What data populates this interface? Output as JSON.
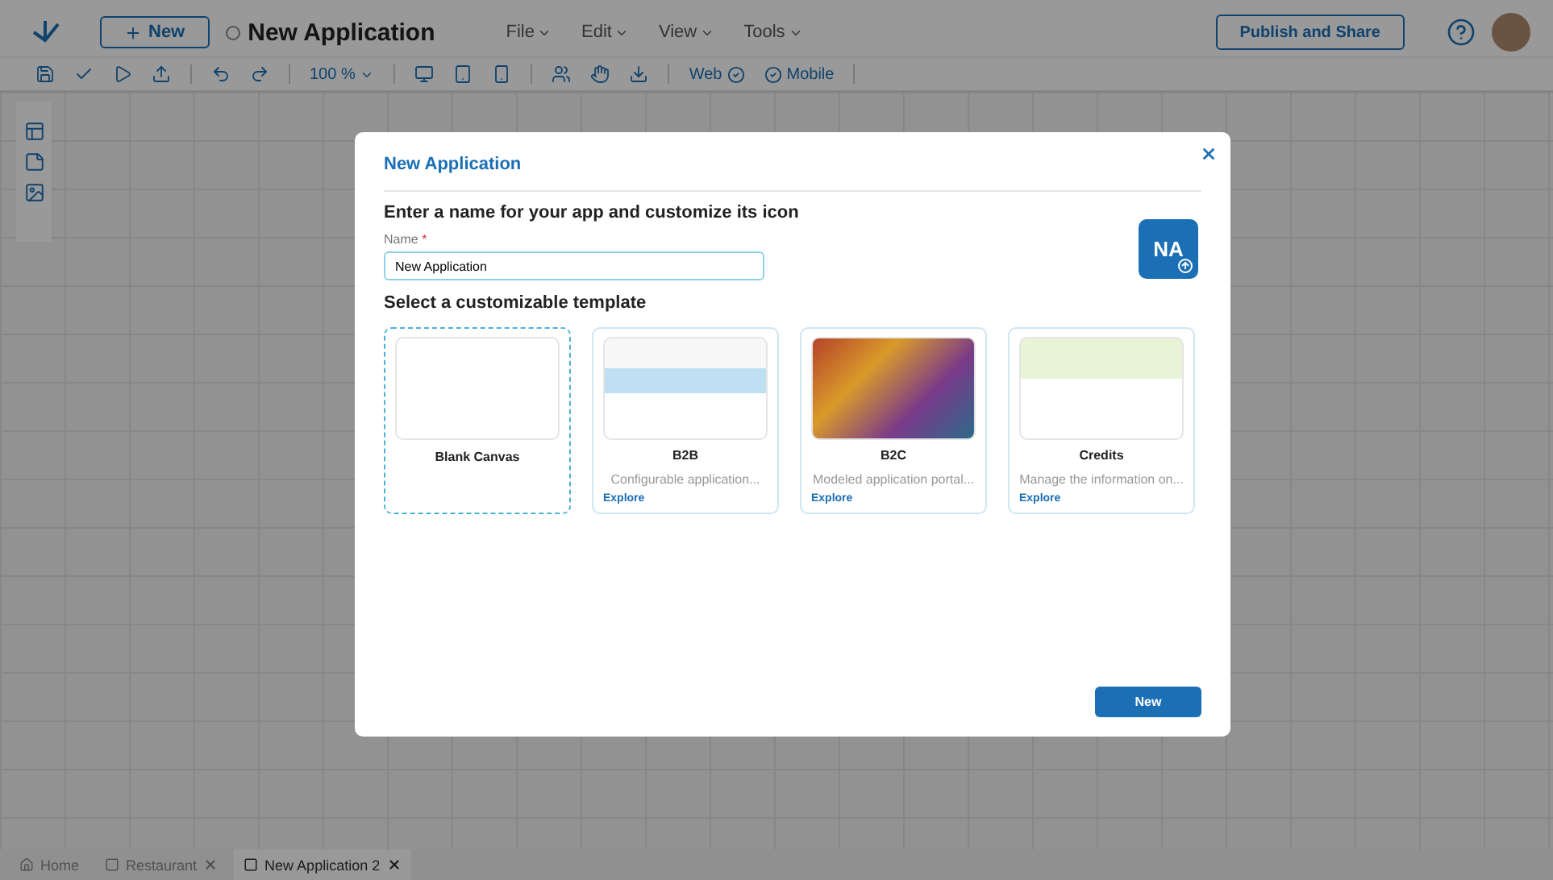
{
  "header": {
    "new_button": "New",
    "app_title": "New Application",
    "menus": [
      "File",
      "Edit",
      "View",
      "Tools"
    ],
    "publish_button": "Publish and Share"
  },
  "toolbar": {
    "zoom": "100 %",
    "web": "Web",
    "mobile": "Mobile"
  },
  "dialog": {
    "title": "New Application",
    "heading": "Enter a name for your app and customize its icon",
    "name_label": "Name",
    "required_mark": "*",
    "name_value": "New Application",
    "icon_initials": "NA",
    "template_heading": "Select a customizable template",
    "templates": [
      {
        "kind": "blank",
        "title": "Blank Canvas",
        "selected": true
      },
      {
        "kind": "template",
        "title": "B2B",
        "description": "Configurable application...",
        "link": "Explore",
        "selected": false
      },
      {
        "kind": "template",
        "title": "B2C",
        "description": "Modeled application portal...",
        "link": "Explore",
        "selected": false
      },
      {
        "kind": "template",
        "title": "Credits",
        "description": "Manage the information on...",
        "link": "Explore",
        "selected": false
      }
    ],
    "submit_button": "New"
  },
  "bottom_tabs": [
    {
      "label": "Home",
      "closable": false,
      "selected": false
    },
    {
      "label": "Restaurant",
      "closable": true,
      "selected": false
    },
    {
      "label": "New Application 2",
      "closable": true,
      "selected": true
    }
  ]
}
